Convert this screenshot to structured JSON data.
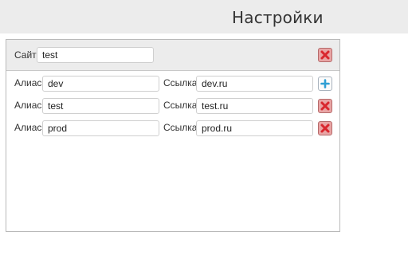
{
  "header": {
    "title": "Настройки"
  },
  "site": {
    "label": "Сайт",
    "value": "test"
  },
  "rows": [
    {
      "alias_label": "Алиас",
      "alias_value": "dev",
      "link_label": "Ссылка",
      "link_value": "dev.ru",
      "action": "add-icon"
    },
    {
      "alias_label": "Алиас",
      "alias_value": "test",
      "link_label": "Ссылка",
      "link_value": "test.ru",
      "action": "delete-icon"
    },
    {
      "alias_label": "Алиас",
      "alias_value": "prod",
      "link_label": "Ссылка",
      "link_value": "prod.ru",
      "action": "delete-icon"
    }
  ],
  "colors": {
    "delete": "#d9272e",
    "add": "#2f9fd4",
    "header_bg": "#ececec"
  }
}
